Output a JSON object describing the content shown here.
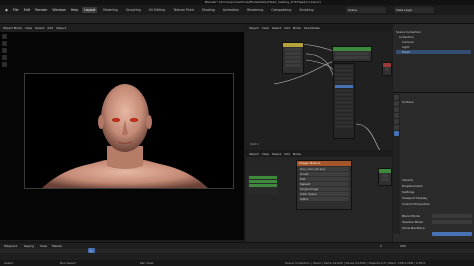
{
  "window": {
    "title": "Blender* [/home/productions/Models/Skin/Head_Casting_TUT/Head/v1.blend]"
  },
  "menubar": {
    "items": [
      "File",
      "Edit",
      "Render",
      "Window",
      "Help"
    ],
    "workspaces": [
      "Layout",
      "Modeling",
      "Sculpting",
      "UV Editing",
      "Texture Paint",
      "Shading",
      "Animation",
      "Rendering",
      "Compositing",
      "Scripting"
    ],
    "active_workspace": "Layout",
    "scene": "Scene",
    "view_layer": "View Layer"
  },
  "viewport": {
    "header": [
      "Object Mode",
      "View",
      "Select",
      "Add",
      "Object"
    ]
  },
  "node_editor": {
    "header": [
      "Object",
      "View",
      "Select",
      "Add",
      "Node",
      "Use Nodes"
    ],
    "lower_header": [
      "Object",
      "View",
      "Select",
      "Add",
      "Node"
    ],
    "label_slot": "Slot 1",
    "image_node": {
      "title": "Image Texture",
      "filename": "skin_color_02.png",
      "fields": [
        "Linear",
        "Flat",
        "Repeat",
        "Single Image",
        "Color Space",
        "Alpha"
      ]
    }
  },
  "outliner": {
    "items": [
      "Scene Collection",
      "Collection",
      "Camera",
      "Light",
      "Head"
    ]
  },
  "properties": {
    "sections": [
      "Surface",
      "Volume",
      "Displacement",
      "Settings",
      "Viewport Display",
      "Custom Properties"
    ],
    "bottom_fields": [
      "Blend Mode",
      "Shadow Mode",
      "Show Backface"
    ]
  },
  "timeline": {
    "menus": [
      "Playback",
      "Keying",
      "View",
      "Marker"
    ],
    "current_frame": "1",
    "start": "1",
    "end": "250"
  },
  "statusbar": {
    "left": "Select",
    "middle": "Box Select",
    "right": "Pan View",
    "info": "Scene Collection | Head | Verts:14,632 | Faces:14,540 | Objects:1/3 | Mem: 148.2 MiB | 2.83.0"
  },
  "colors": {
    "accent": "#4772b3",
    "image_node_header": "#a6542a",
    "shader_node_header": "#3d8a3d"
  }
}
